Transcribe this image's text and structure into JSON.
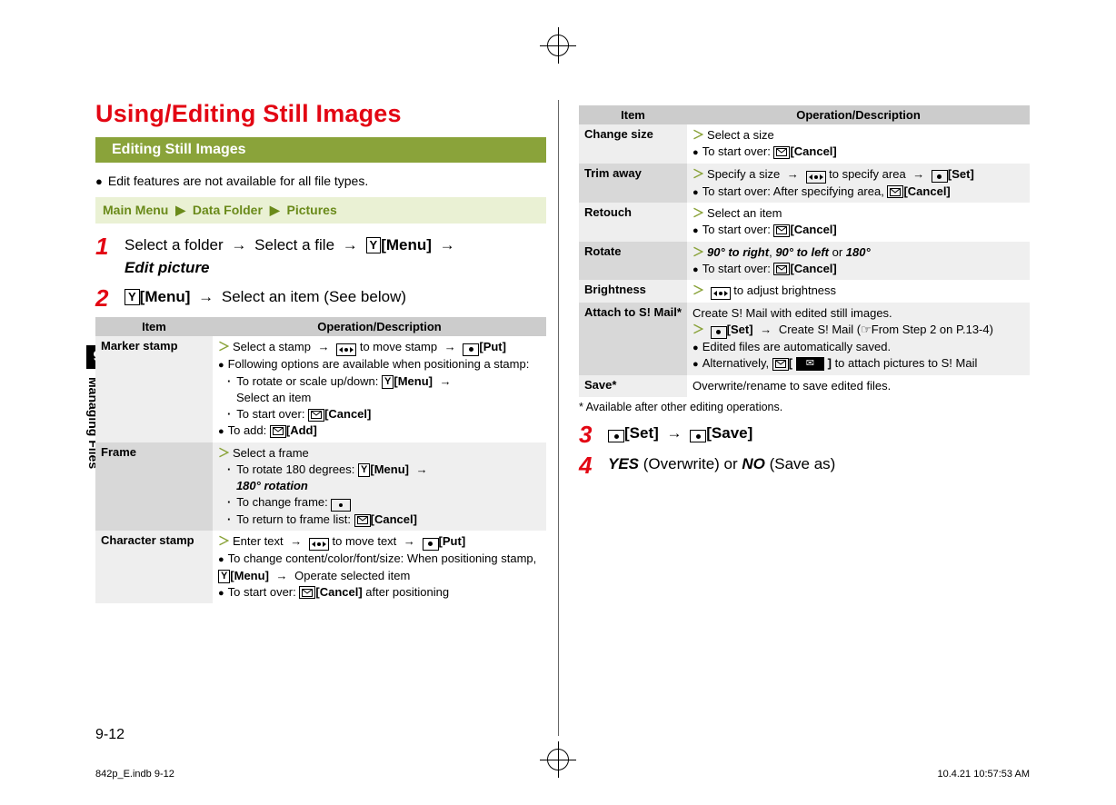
{
  "heading": "Using/Editing Still Images",
  "sub_heading": "Editing Still Images",
  "note1": "Edit features are not available for all file types.",
  "nav": {
    "a": "Main Menu",
    "b": "Data Folder",
    "c": "Pictures",
    "sep": "▶"
  },
  "steps": {
    "s1_a": "Select a folder",
    "s1_b": "Select a file",
    "s1_menu": "[Menu]",
    "s1_ep": "Edit picture",
    "s2_menu": "[Menu]",
    "s2_b": "Select an item (See below)",
    "s3_a": "[Set]",
    "s3_b": "[Save]",
    "s4_a": "YES",
    "s4_mid": " (Overwrite) or ",
    "s4_b": "NO",
    "s4_end": " (Save as)"
  },
  "th_item": "Item",
  "th_od": "Operation/Description",
  "table1": {
    "r1_item": "Marker stamp",
    "r1_l1_a": "Select a stamp",
    "r1_l1_b": "to move stamp",
    "r1_l1_put": "[Put]",
    "r1_l2": "Following options are available when positioning a stamp:",
    "r1_l3": "To rotate or scale up/down:",
    "r1_l3b": "[Menu]",
    "r1_l3c": "Select an item",
    "r1_l4": "To start over:",
    "r1_l4b": "[Cancel]",
    "r1_l5": "To add:",
    "r1_l5b": "[Add]",
    "r2_item": "Frame",
    "r2_l1": "Select a frame",
    "r2_l2": "To rotate 180 degrees:",
    "r2_l2b": "[Menu]",
    "r2_l2c": "180° rotation",
    "r2_l3": "To change frame:",
    "r2_l4": "To return to frame list:",
    "r2_l4b": "[Cancel]",
    "r3_item": "Character stamp",
    "r3_l1a": "Enter text",
    "r3_l1b": "to move text",
    "r3_l1c": "[Put]",
    "r3_l2": "To change content/color/font/size: When positioning stamp,",
    "r3_l2b": "[Menu]",
    "r3_l2c": "Operate selected item",
    "r3_l3": "To start over:",
    "r3_l3b": "[Cancel]",
    "r3_l3c": "after positioning"
  },
  "table2": {
    "r1_item": "Change size",
    "r1_l1": "Select a size",
    "r1_l2": "To start over:",
    "r1_l2b": "[Cancel]",
    "r2_item": "Trim away",
    "r2_l1a": "Specify a size",
    "r2_l1b": "to specify area",
    "r2_l1c": "[Set]",
    "r2_l2": "To start over: After specifying area,",
    "r2_l2b": "[Cancel]",
    "r3_item": "Retouch",
    "r3_l1": "Select an item",
    "r3_l2": "To start over:",
    "r3_l2b": "[Cancel]",
    "r4_item": "Rotate",
    "r4_a": "90° to right",
    "r4_b": "90° to left",
    "r4_or": " or ",
    "r4_c": "180°",
    "r4_l2": "To start over:",
    "r4_l2b": "[Cancel]",
    "r5_item": "Brightness",
    "r5_l1": "to adjust brightness",
    "r6_item": "Attach to S! Mail*",
    "r6_l1": "Create S! Mail with edited still images.",
    "r6_l2a": "[Set]",
    "r6_l2b": "Create S! Mail (☞From Step 2 on P.13-4)",
    "r6_l3": "Edited files are automatically saved.",
    "r6_l4": "Alternatively,",
    "r6_l4b": "to attach pictures to S! Mail",
    "r7_item": "Save*",
    "r7_l1": "Overwrite/rename to save edited files."
  },
  "table2_note": "* Available after other editing operations.",
  "side_num": "9",
  "side_label": "Managing Files",
  "page_num": "9-12",
  "footer_left": "842p_E.indb   9-12",
  "footer_right": "10.4.21   10:57:53 AM"
}
